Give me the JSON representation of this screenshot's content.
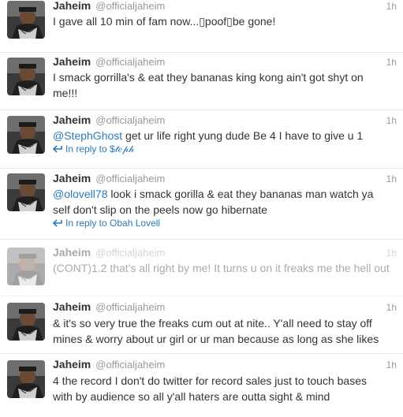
{
  "tweets": [
    {
      "name": "Jaheim",
      "handle": "@officialjaheim",
      "time": "1h",
      "text": "I gave all 10 min of fam now...▯poof▯be gone!"
    },
    {
      "name": "Jaheim",
      "handle": "@officialjaheim",
      "time": "1h",
      "line1": "I smack gorrilla's & eat they bananas king kong ain't got shyt on",
      "line2": "me!!!"
    },
    {
      "name": "Jaheim",
      "handle": "@officialjaheim",
      "time": "1h",
      "mention": "@StephGhost",
      "text": " get ur life right yung dude Be 4 I have to give u 1",
      "reply_label": "In reply to $𝓉𝑒𝓅𝒽"
    },
    {
      "name": "Jaheim",
      "handle": "@officialjaheim",
      "time": "1h",
      "mention": "@olovell78",
      "line1_rest": " look i smack gorilla & eat they bananas man watch ya",
      "line2": "self don't slip on the peels now go hibernate",
      "reply_label": "In reply to Obah Lovell"
    },
    {
      "name": "Jaheim",
      "handle": "@officialjaheim",
      "time": "1h",
      "text": "(CONT)1.2 that's all right by me! It turns u on it freaks me the hell out"
    },
    {
      "name": "Jaheim",
      "handle": "@officialjaheim",
      "time": "1h",
      "line1": "& it's so very true the freaks cum out at nite.. Y'all need to stay off",
      "line2": "mines & worry about ur girl or ur man because as long as she likes"
    },
    {
      "name": "Jaheim",
      "handle": "@officialjaheim",
      "time": "1h",
      "line1": "4 the record I don't do twitter for record sales just to touch bases",
      "line2": "with by audience so all y'all haters are outta sight & mind"
    }
  ],
  "colors": {
    "link": "#2b7bb9",
    "meta": "#999999",
    "text": "#333333"
  }
}
